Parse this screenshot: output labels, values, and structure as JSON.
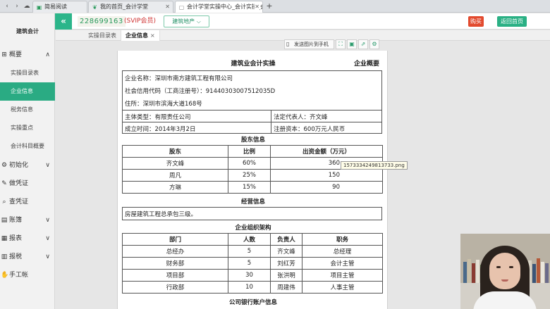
{
  "browser": {
    "tabs": [
      {
        "label": "简易阅读",
        "icon": "green-page-icon"
      },
      {
        "label": "我的首页_会计学堂",
        "icon": "leaf-icon"
      },
      {
        "label": "会计学堂实操中心_会计实操_会",
        "icon": "page-icon"
      }
    ]
  },
  "header": {
    "phone": "228699163",
    "vip": "(SVIP会员)",
    "industry": "建筑地产 ⌵",
    "buy": "购买",
    "home": "返回首页"
  },
  "sidebar": {
    "brand": "建筑会计",
    "sections": [
      {
        "label": "概要",
        "icon": "grid-icon",
        "chevron": "∧"
      },
      {
        "label": "初始化",
        "icon": "gear-icon",
        "chevron": "∨"
      },
      {
        "label": "做凭证",
        "icon": "pencil-icon",
        "chevron": ""
      },
      {
        "label": "查凭证",
        "icon": "search-icon",
        "chevron": ""
      },
      {
        "label": "账簿",
        "icon": "book-icon",
        "chevron": "∨"
      },
      {
        "label": "报表",
        "icon": "report-icon",
        "chevron": "∨"
      },
      {
        "label": "报税",
        "icon": "tax-icon",
        "chevron": "∨"
      },
      {
        "label": "手工帐",
        "icon": "hand-icon",
        "chevron": ""
      }
    ],
    "sub_items": [
      "实操目录表",
      "企业信息",
      "税务信息",
      "实操重点",
      "会计科目概要"
    ]
  },
  "page_tabs": [
    {
      "label": "实操目录表"
    },
    {
      "label": "企业信息",
      "close": "×"
    }
  ],
  "toolbar": {
    "send": "发送图片到手机"
  },
  "document": {
    "title": "建筑业会计实操",
    "right_title": "企业概要",
    "company_name": "企业名称：深圳市南方建筑工程有限公司",
    "credit_code": "社会信用代码（工商注册号）：91440303007512035D",
    "address": "住所：深圳市滨海大道168号",
    "entity_type": "主体类型：有限责任公司",
    "legal_rep": "法定代表人：齐文峰",
    "founded": "成立时间：2014年3月2日",
    "capital": "注册资本：600万元人民币",
    "shareholders_title": "股东信息",
    "shareholders_headers": [
      "股东",
      "比例",
      "出资金额（万元）"
    ],
    "shareholders": [
      {
        "name": "齐文峰",
        "ratio": "60%",
        "amount": "360"
      },
      {
        "name": "周凡",
        "ratio": "25%",
        "amount": "150"
      },
      {
        "name": "方琳",
        "ratio": "15%",
        "amount": "90"
      }
    ],
    "business_title": "经营信息",
    "business_scope": "房屋建筑工程总承包三级。",
    "org_title": "企业组织架构",
    "org_headers": [
      "部门",
      "人数",
      "负责人",
      "职务"
    ],
    "org": [
      {
        "dept": "总经办",
        "count": "5",
        "head": "齐文峰",
        "title": "总经理"
      },
      {
        "dept": "财务部",
        "count": "5",
        "head": "刘红芳",
        "title": "会计主管"
      },
      {
        "dept": "项目部",
        "count": "30",
        "head": "张洪明",
        "title": "项目主管"
      },
      {
        "dept": "行政部",
        "count": "10",
        "head": "周建伟",
        "title": "人事主管"
      }
    ],
    "bank_title": "公司银行账户信息",
    "tooltip": "1573334249813733.png"
  }
}
